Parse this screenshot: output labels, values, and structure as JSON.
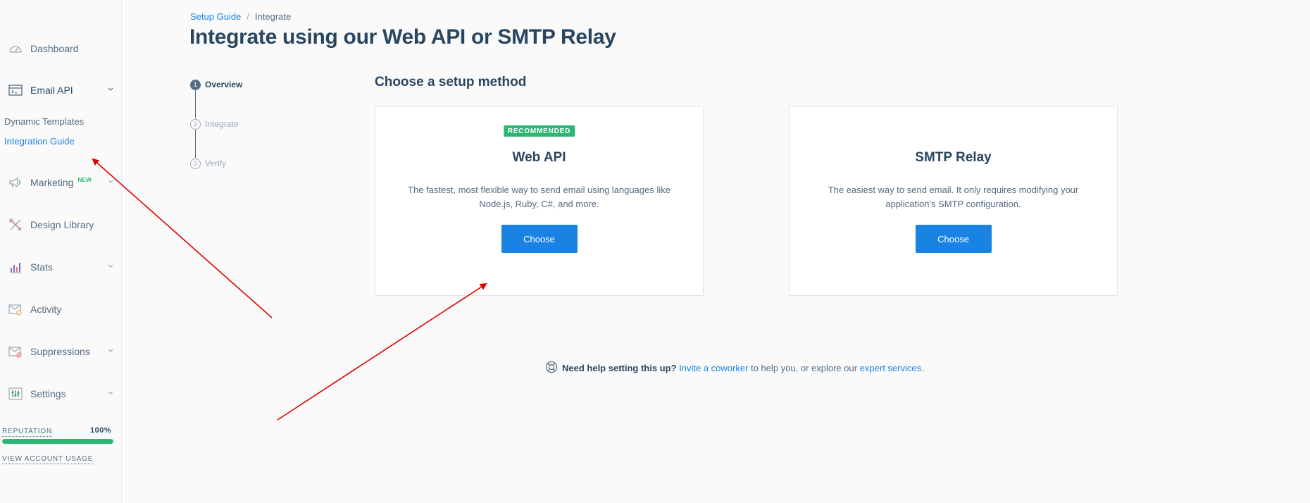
{
  "sidebar": {
    "items": [
      {
        "label": "Dashboard",
        "icon": "gauge-icon"
      },
      {
        "label": "Email API",
        "icon": "terminal-icon"
      },
      {
        "label": "Marketing",
        "icon": "megaphone-icon",
        "badge": "NEW"
      },
      {
        "label": "Design Library",
        "icon": "design-tools-icon"
      },
      {
        "label": "Stats",
        "icon": "bar-chart-icon"
      },
      {
        "label": "Activity",
        "icon": "mail-search-icon"
      },
      {
        "label": "Suppressions",
        "icon": "mail-blocked-icon"
      },
      {
        "label": "Settings",
        "icon": "sliders-icon"
      }
    ],
    "subitems": [
      {
        "label": "Dynamic Templates",
        "active": false
      },
      {
        "label": "Integration Guide",
        "active": true
      }
    ],
    "reputation": {
      "label": "REPUTATION",
      "value_text": "100%",
      "value": 1.0
    },
    "usage_link": "VIEW ACCOUNT USAGE"
  },
  "breadcrumb": {
    "parent": "Setup Guide",
    "separator": "/",
    "current": "Integrate"
  },
  "page_title": "Integrate using our Web API or SMTP Relay",
  "steps": [
    {
      "number": "1",
      "label": "Overview",
      "active": true
    },
    {
      "number": "2",
      "label": "Integrate",
      "active": false
    },
    {
      "number": "3",
      "label": "Verify",
      "active": false
    }
  ],
  "section_title": "Choose a setup method",
  "cards": {
    "web": {
      "badge": "RECOMMENDED",
      "title": "Web API",
      "description": "The fastest, most flexible way to send email using languages like Node.js, Ruby, C#, and more.",
      "button": "Choose"
    },
    "smtp": {
      "title": "SMTP Relay",
      "description": "The easiest way to send email. It only requires modifying your application's SMTP configuration.",
      "button": "Choose"
    }
  },
  "help": {
    "icon": "lifebuoy-icon",
    "bold": "Need help setting this up?",
    "link1": "Invite a coworker",
    "middle": " to help you, or explore our ",
    "link2": "expert services",
    "end": "."
  },
  "colors": {
    "accent": "#1a82e2",
    "success": "#2bb673",
    "text_dark": "#294661",
    "text_muted": "#546b81",
    "annotation": "#e00000"
  }
}
